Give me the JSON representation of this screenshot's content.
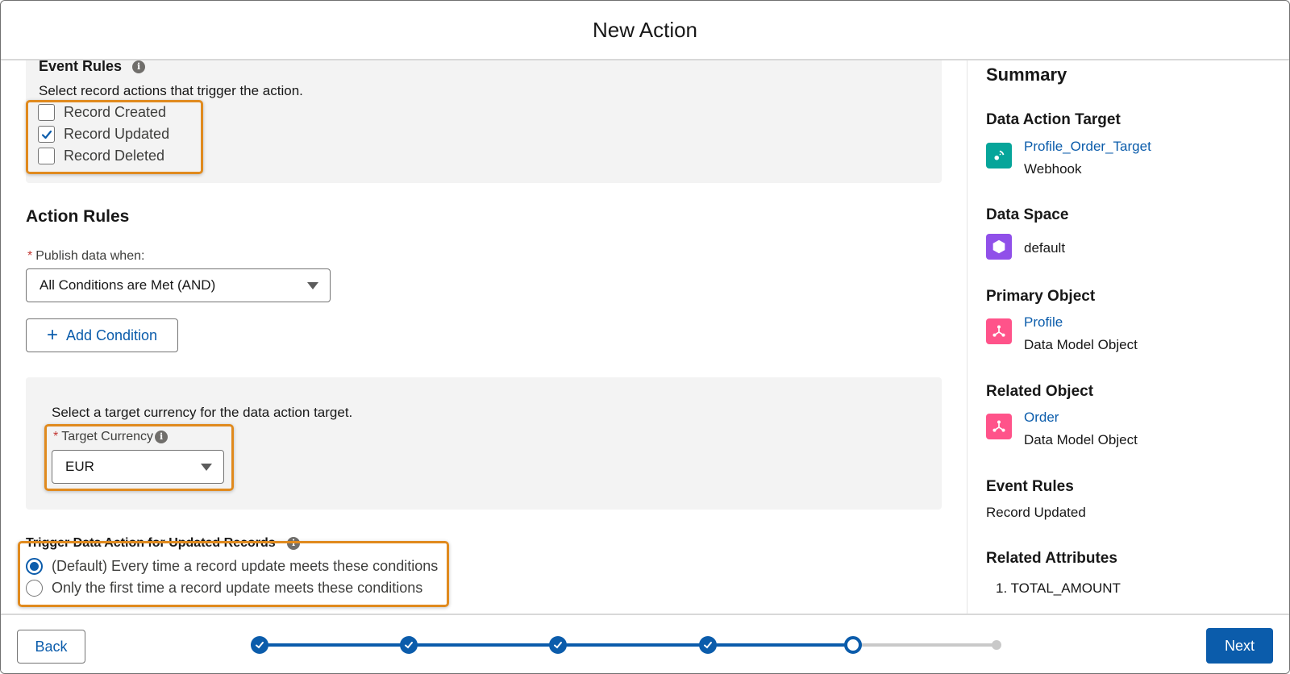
{
  "header": {
    "title": "New Action"
  },
  "event_rules": {
    "heading": "Event Rules",
    "description": "Select record actions that trigger the action.",
    "options": [
      {
        "label": "Record Created",
        "checked": false
      },
      {
        "label": "Record Updated",
        "checked": true
      },
      {
        "label": "Record Deleted",
        "checked": false
      }
    ]
  },
  "action_rules": {
    "heading": "Action Rules",
    "publish_label": "Publish data when:",
    "publish_value": "All Conditions are Met (AND)",
    "add_condition_label": "Add Condition"
  },
  "currency": {
    "description": "Select a target currency for the data action target.",
    "label": "Target Currency",
    "value": "EUR"
  },
  "trigger": {
    "heading": "Trigger Data Action for Updated Records",
    "options": [
      {
        "label": "(Default) Every time a record update meets these conditions",
        "selected": true
      },
      {
        "label": "Only the first time a record update meets these conditions",
        "selected": false
      }
    ]
  },
  "summary": {
    "title": "Summary",
    "target": {
      "heading": "Data Action Target",
      "name": "Profile_Order_Target",
      "type": "Webhook",
      "icon": "webhook-icon",
      "color": "#06a59a"
    },
    "data_space": {
      "heading": "Data Space",
      "name": "default",
      "icon": "data-space-icon",
      "color": "#9050e9"
    },
    "primary_object": {
      "heading": "Primary Object",
      "name": "Profile",
      "type": "Data Model Object",
      "icon": "data-model-icon",
      "color": "#ff538a"
    },
    "related_object": {
      "heading": "Related Object",
      "name": "Order",
      "type": "Data Model Object",
      "icon": "data-model-icon",
      "color": "#ff538a"
    },
    "event_rules": {
      "heading": "Event Rules",
      "value": "Record Updated"
    },
    "related_attributes": {
      "heading": "Related Attributes",
      "items": [
        "1. TOTAL_AMOUNT"
      ]
    }
  },
  "footer": {
    "back_label": "Back",
    "next_label": "Next",
    "progress": {
      "total_steps": 6,
      "current_step": 5
    }
  },
  "colors": {
    "brand": "#0b5cab",
    "highlight": "#e08a1e",
    "required": "#c23934"
  }
}
